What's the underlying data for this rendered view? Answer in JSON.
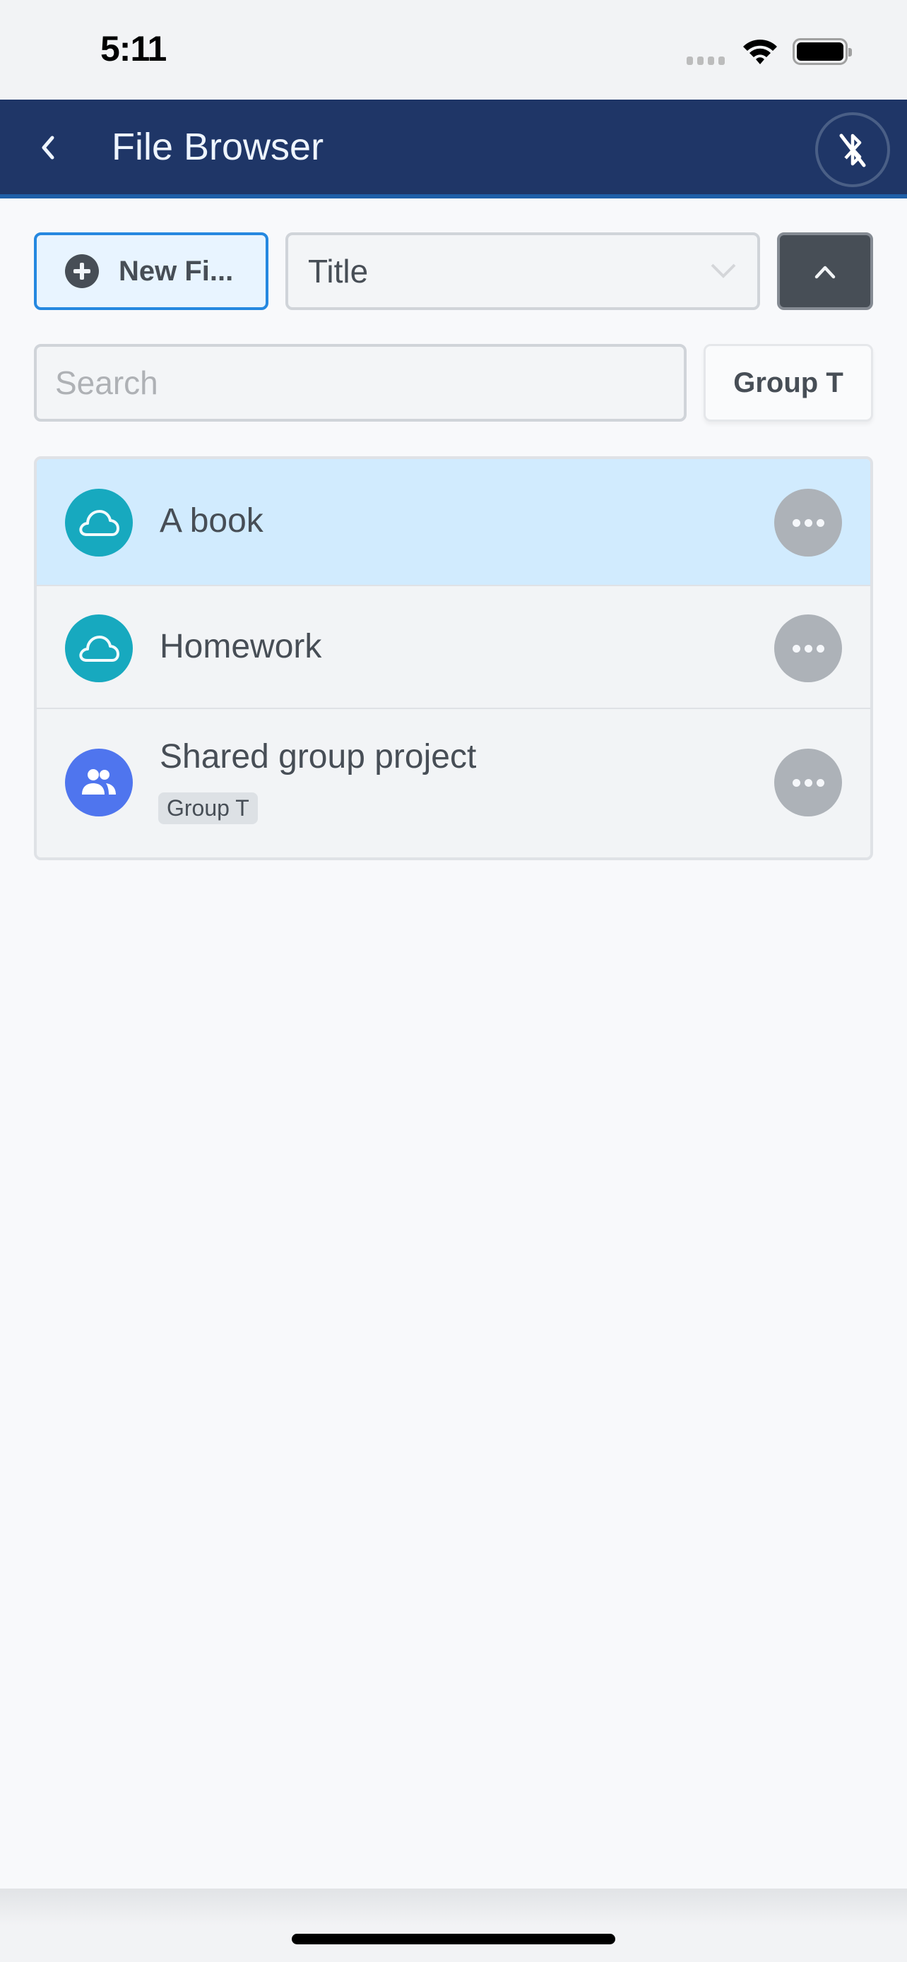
{
  "status_bar": {
    "time": "5:11",
    "icons": [
      "cellular-signal-icon",
      "wifi-icon",
      "battery-icon"
    ]
  },
  "header": {
    "back_icon": "chevron-left-icon",
    "title": "File Browser",
    "bluetooth_icon": "bluetooth-disabled-icon"
  },
  "toolbar": {
    "new_file_label": "New Fi...",
    "new_file_icon": "plus-circle-icon",
    "sort_field": "Title",
    "sort_direction_icon": "chevron-up-icon"
  },
  "search": {
    "placeholder": "Search",
    "value": "",
    "group_filter_label": "Group T"
  },
  "files": [
    {
      "name": "A book",
      "icon": "cloud-icon",
      "selected": true,
      "group": null
    },
    {
      "name": "Homework",
      "icon": "cloud-icon",
      "selected": false,
      "group": null
    },
    {
      "name": "Shared group project",
      "icon": "group-icon",
      "selected": false,
      "group": "Group T"
    }
  ],
  "colors": {
    "header_bg": "#1f3667",
    "header_accent": "#1f5fa8",
    "primary": "#2588e0",
    "selected_row": "#d1ebfe",
    "cloud_icon_bg": "#17a9bf",
    "group_icon_bg": "#4f75ee",
    "more_button": "#adb2b8"
  }
}
